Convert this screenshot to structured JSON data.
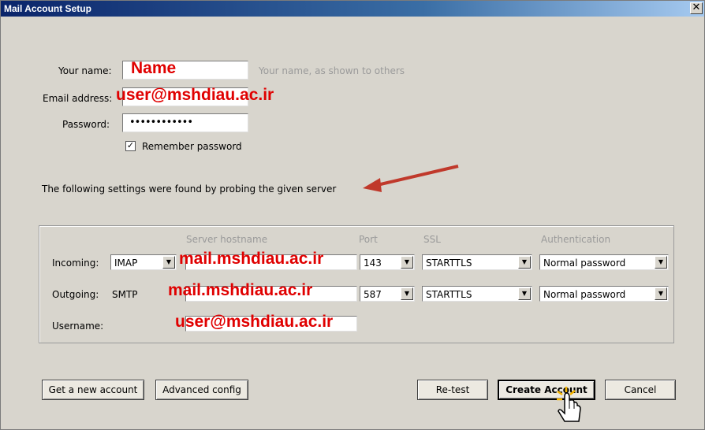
{
  "window": {
    "title": "Mail Account Setup",
    "close_glyph": "✕"
  },
  "form": {
    "name_label": "Your name:",
    "name_value": "Name",
    "name_hint": "Your name, as shown to others",
    "email_label": "Email address:",
    "email_value": "user@mshdiau.ac.ir",
    "password_label": "Password:",
    "password_value": "••••••••••••",
    "remember_label": "Remember password",
    "remember_checked": true
  },
  "probe_message": "The following settings were found by probing the given server",
  "server": {
    "headers": {
      "hostname": "Server hostname",
      "port": "Port",
      "ssl": "SSL",
      "auth": "Authentication"
    },
    "incoming": {
      "label": "Incoming:",
      "protocol": "IMAP",
      "hostname": "mail.mshdiau.ac.ir",
      "port": "143",
      "ssl": "STARTTLS",
      "auth": "Normal password"
    },
    "outgoing": {
      "label": "Outgoing:",
      "protocol": "SMTP",
      "hostname": "mail.mshdiau.ac.ir",
      "port": "587",
      "ssl": "STARTTLS",
      "auth": "Normal password"
    },
    "username": {
      "label": "Username:",
      "value": "user@mshdiau.ac.ir"
    }
  },
  "buttons": {
    "get_account": "Get a new account",
    "advanced": "Advanced config",
    "retest": "Re-test",
    "create": "Create Account",
    "cancel": "Cancel"
  },
  "colors": {
    "highlight_text": "#e00000",
    "arrow": "#c0392b"
  }
}
